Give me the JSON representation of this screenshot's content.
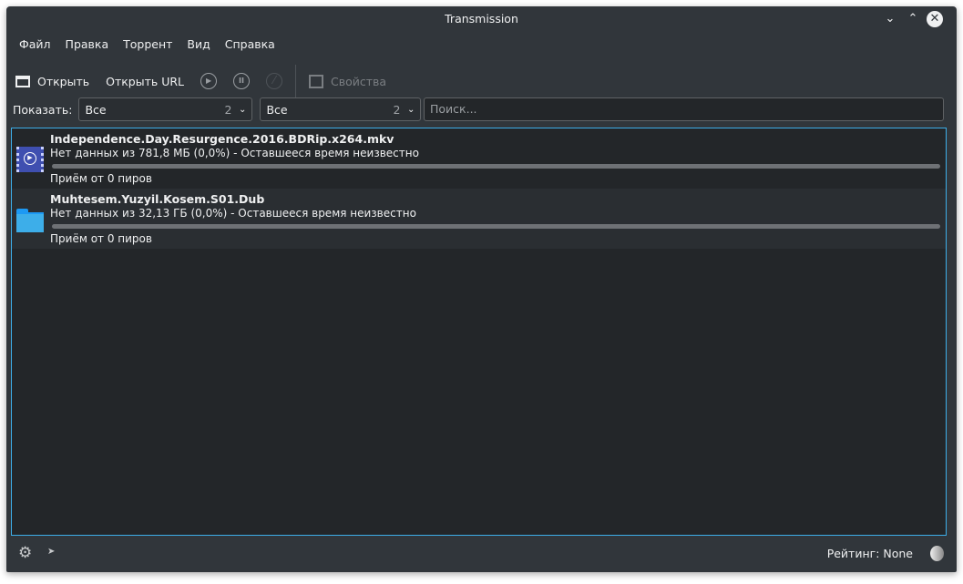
{
  "window": {
    "title": "Transmission"
  },
  "menu": [
    "Файл",
    "Правка",
    "Торрент",
    "Вид",
    "Справка"
  ],
  "toolbar": {
    "open": "Открыть",
    "open_url": "Открыть URL",
    "properties": "Свойства"
  },
  "filter": {
    "label": "Показать:",
    "activity": {
      "value": "Все",
      "count": "2"
    },
    "tracker": {
      "value": "Все",
      "count": "2"
    },
    "search_placeholder": "Поиск..."
  },
  "torrents": [
    {
      "name": "Independence.Day.Resurgence.2016.BDRip.x264.mkv",
      "status": "Нет данных из 781,8 МБ (0,0%) - Оставшееся время неизвестно",
      "peers": "Приём от 0 пиров",
      "progress": 0,
      "icon": "video-file-icon"
    },
    {
      "name": "Muhtesem.Yuzyil.Kosem.S01.Dub",
      "status": "Нет данных из 32,13 ГБ (0,0%) - Оставшееся время неизвестно",
      "peers": "Приём от 0 пиров",
      "progress": 0,
      "icon": "folder-icon"
    }
  ],
  "statusbar": {
    "rating": "Рейтинг: None"
  }
}
